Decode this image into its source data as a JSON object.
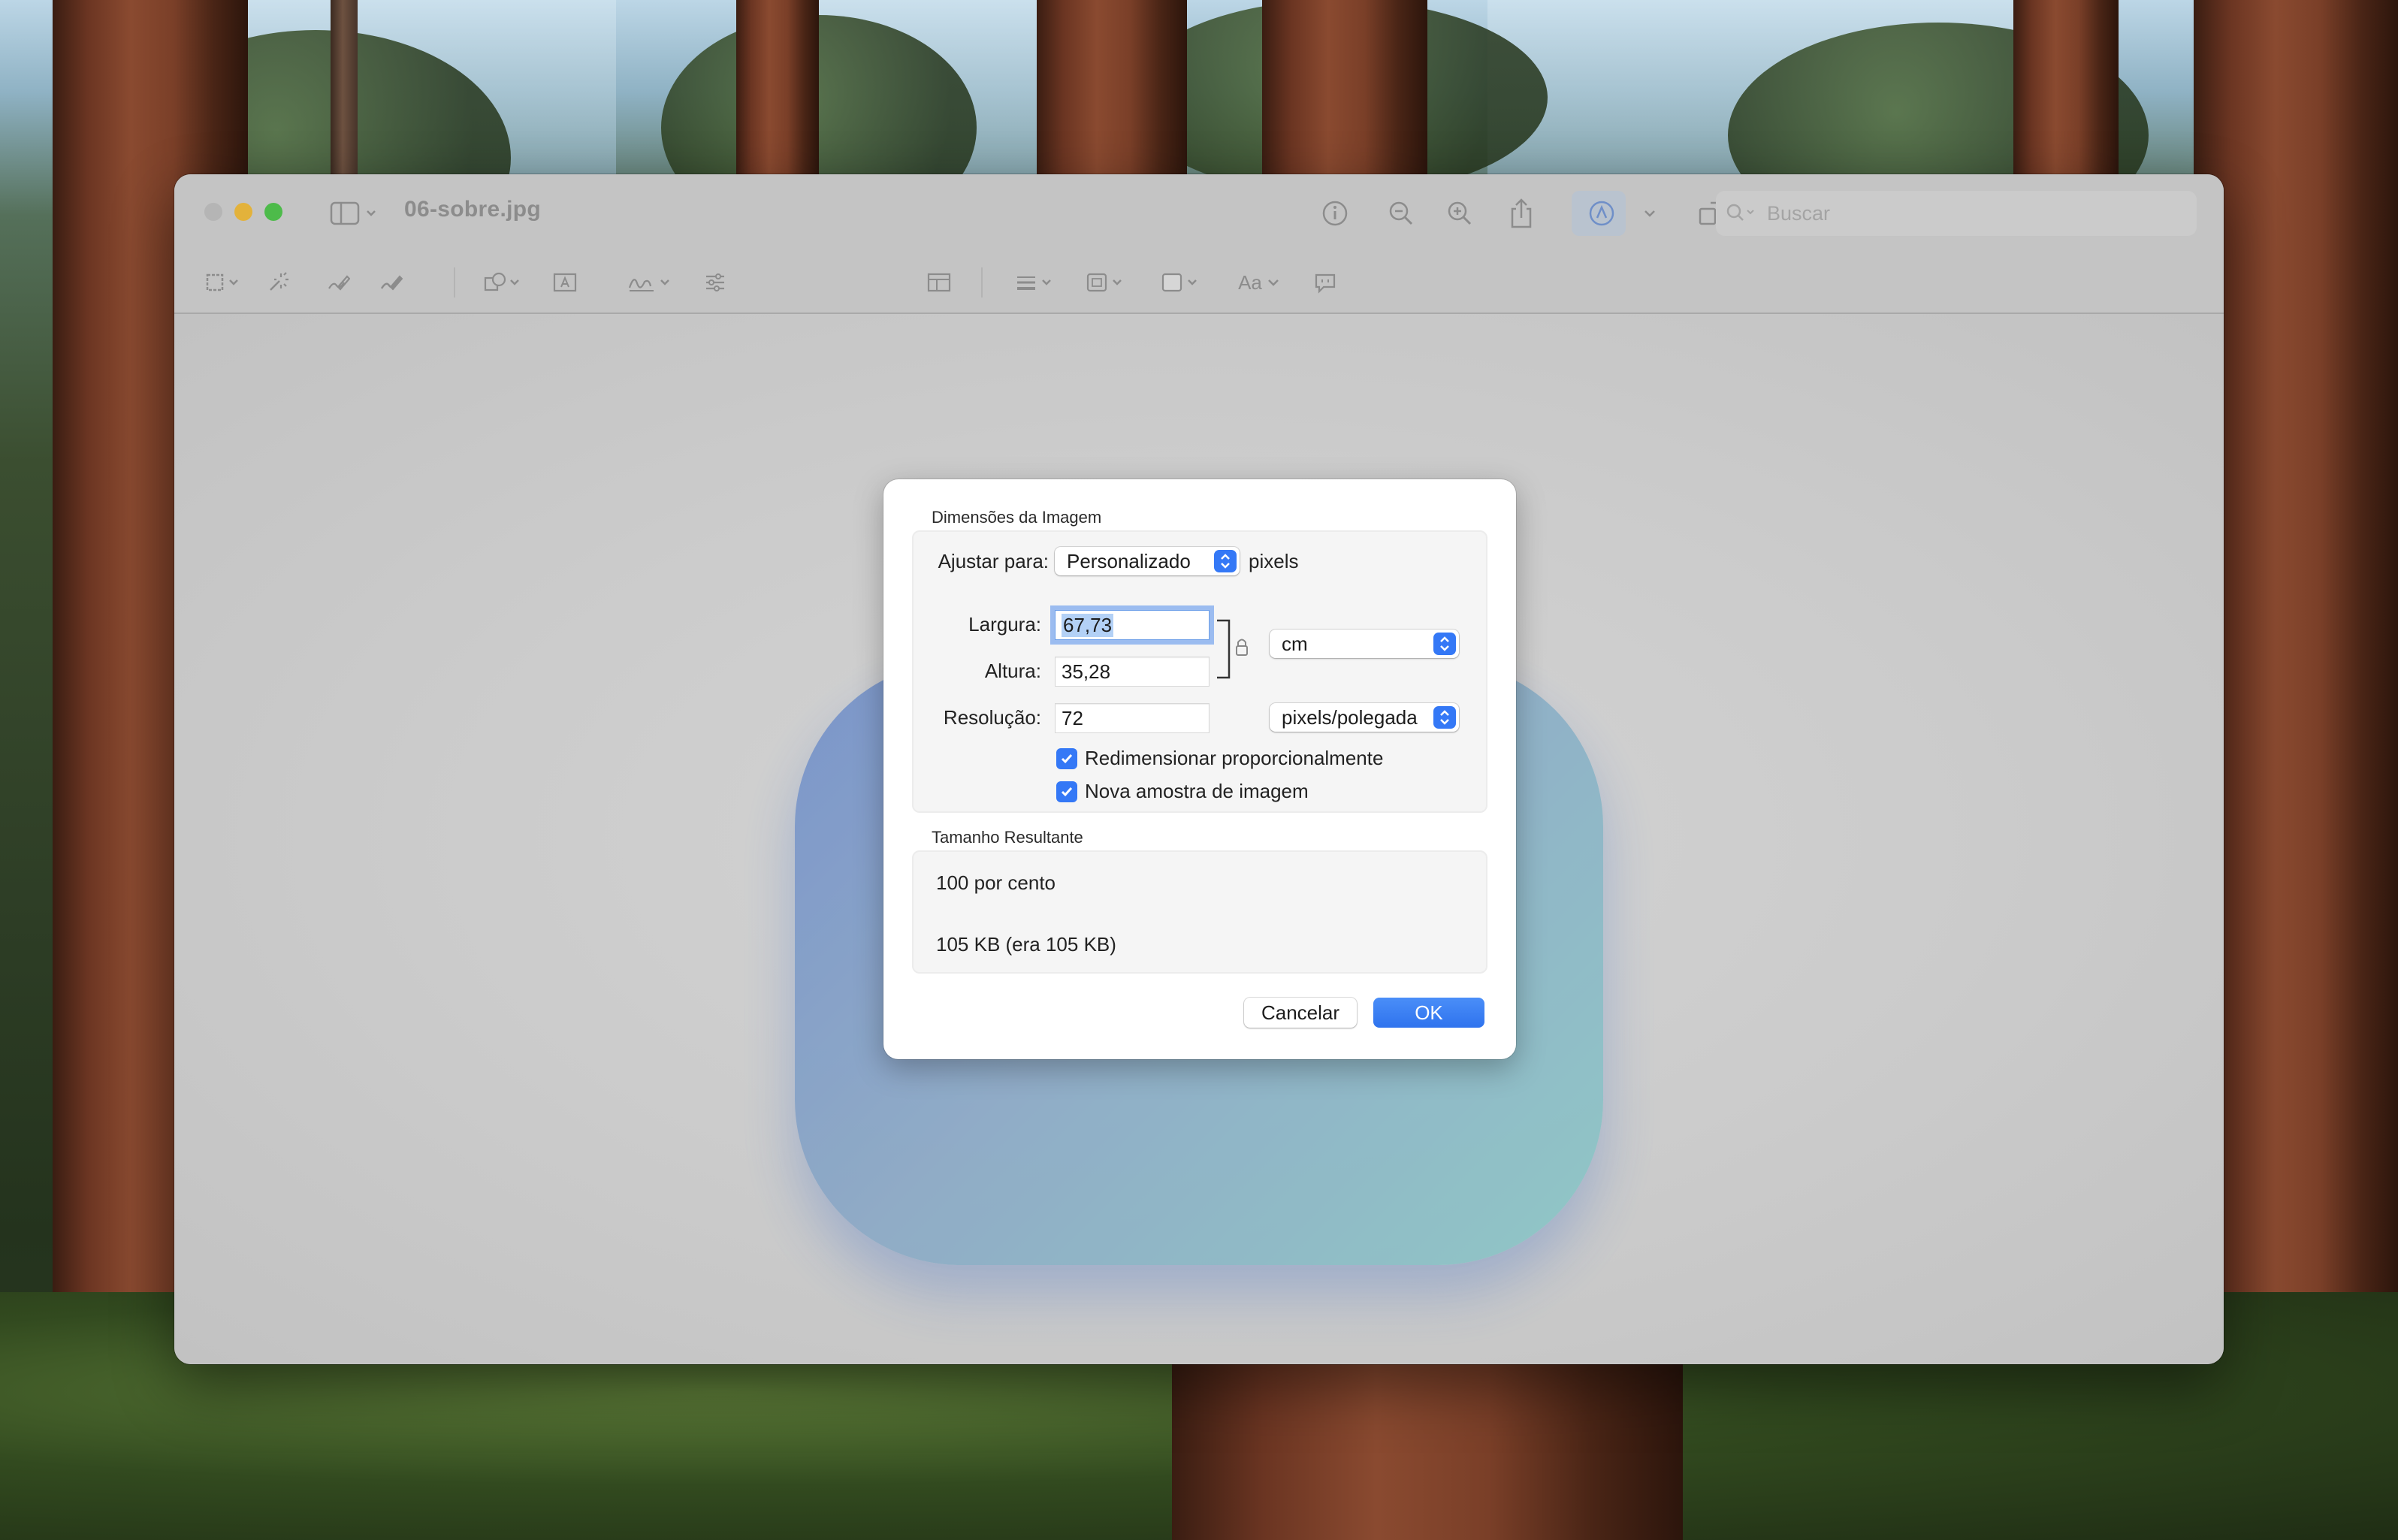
{
  "window": {
    "title": "06-sobre.jpg",
    "search_placeholder": "Buscar",
    "toolbar_icons": [
      "sidebar-icon",
      "info-icon",
      "zoom-out-icon",
      "zoom-in-icon",
      "share-icon",
      "highlight-pen-icon",
      "rotate-icon",
      "markup-icon",
      "form-fill-icon",
      "search-icon"
    ],
    "markup_icons": [
      "rect-selection-icon",
      "instant-alpha-icon",
      "sketch-icon",
      "draw-icon",
      "shapes-icon",
      "text-box-icon",
      "signature-icon",
      "adjust-color-icon",
      "adjust-size-icon",
      "shape-style-icon",
      "border-color-icon",
      "fill-color-icon",
      "text-style-icon",
      "note-icon"
    ],
    "markup_text_style_label": "Aa"
  },
  "dialog": {
    "image_dimensions_title": "Dimensões da Imagem",
    "fit_label": "Ajustar para:",
    "fit_value": "Personalizado",
    "fit_unit": "pixels",
    "width_label": "Largura:",
    "width_value": "67,73",
    "height_label": "Altura:",
    "height_value": "35,28",
    "size_unit": "cm",
    "resolution_label": "Resolução:",
    "resolution_value": "72",
    "resolution_unit": "pixels/polegada",
    "scale_proportionally_label": "Redimensionar proporcionalmente",
    "scale_proportionally_checked": true,
    "resample_label": "Nova amostra de imagem",
    "resample_checked": true,
    "result_title": "Tamanho Resultante",
    "result_percent": "100 por cento",
    "result_size": "105 KB (era 105 KB)",
    "cancel_label": "Cancelar",
    "ok_label": "OK"
  },
  "colors": {
    "accent": "#3478f6",
    "close": "#b5b5b5",
    "minimize": "#e3b23b",
    "maximize": "#4dbb4a"
  }
}
